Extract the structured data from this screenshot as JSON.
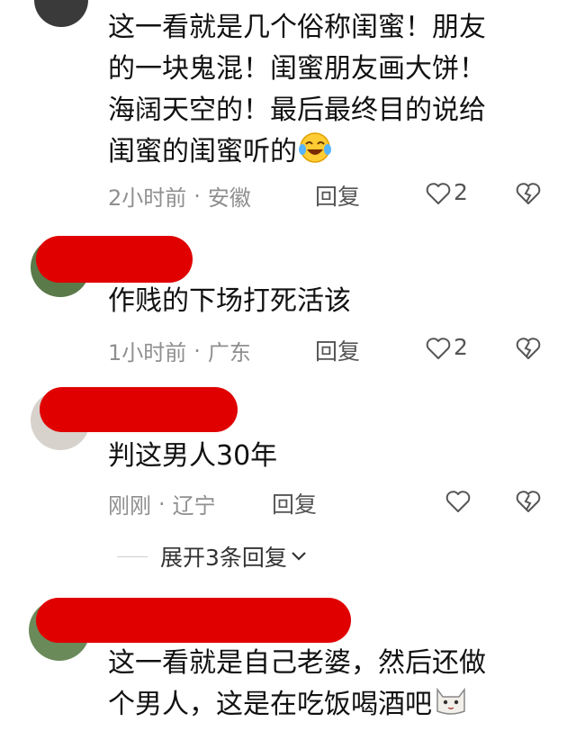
{
  "comments": [
    {
      "lines": [
        "这一看就是几个俗称闺蜜！朋友",
        "的一块鬼混！闺蜜朋友画大饼！",
        "海阔天空的！最后最终目的说给",
        "闺蜜的闺蜜听的"
      ],
      "emoji": "laughing-tears-emoji",
      "time": "2小时前",
      "location": "安徽",
      "reply": "回复",
      "likes": "2"
    },
    {
      "lines": [
        "作贱的下场打死活该"
      ],
      "time": "1小时前",
      "location": "广东",
      "reply": "回复",
      "likes": "2"
    },
    {
      "lines": [
        "判这男人30年"
      ],
      "time": "刚刚",
      "location": "辽宁",
      "reply": "回复",
      "likes": ""
    },
    {
      "lines": [
        "这一看就是自己老婆，然后还做",
        "个男人，这是在吃饭喝酒吧"
      ],
      "emoji": "cat-emoji"
    }
  ],
  "expand_replies": "展开3条回复",
  "colors": {
    "redaction": "#e00000",
    "meta": "#8f8f8f"
  }
}
